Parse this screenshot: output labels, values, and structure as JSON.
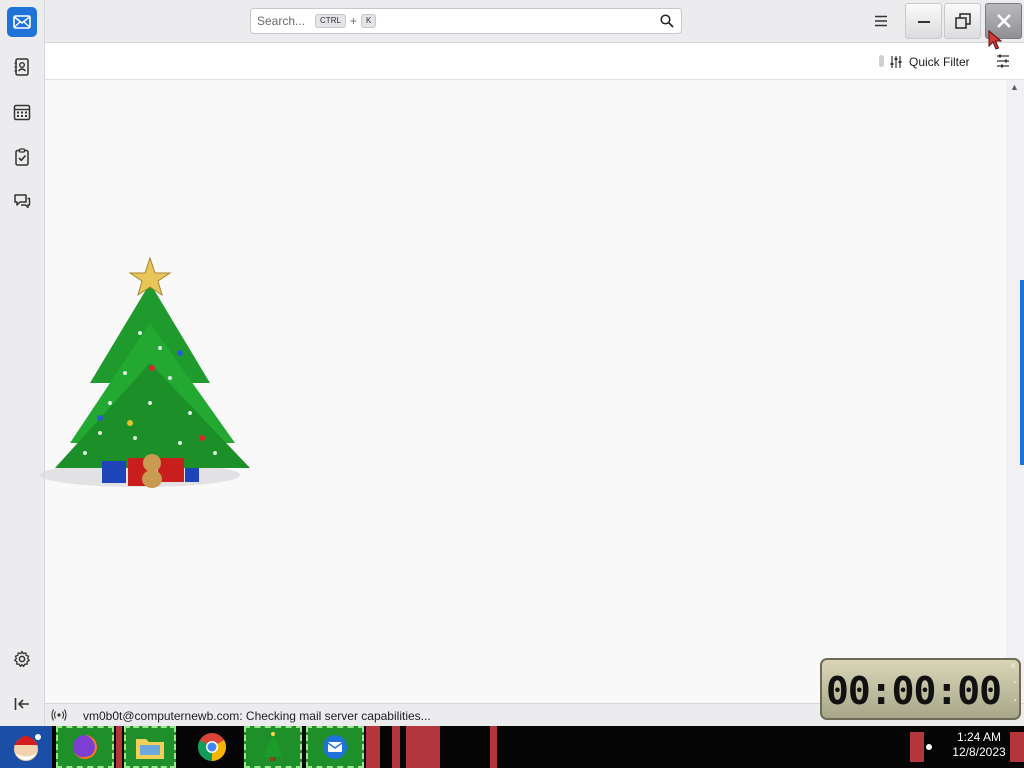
{
  "spaces": {
    "items": [
      {
        "name": "mail",
        "icon": "envelope-icon",
        "active": true
      },
      {
        "name": "address-book",
        "icon": "address-book-icon"
      },
      {
        "name": "calendar",
        "icon": "calendar-icon"
      },
      {
        "name": "tasks",
        "icon": "tasks-icon"
      },
      {
        "name": "chat",
        "icon": "chat-icon"
      }
    ],
    "bottom": [
      {
        "name": "settings",
        "icon": "gear-icon"
      },
      {
        "name": "collapse",
        "icon": "collapse-left-icon"
      }
    ]
  },
  "titlebar": {
    "search": {
      "placeholder": "Search...",
      "shortcut_mod": "CTRL",
      "shortcut_plus": "+",
      "shortcut_key": "K"
    }
  },
  "listbar": {
    "quick_filter_label": "Quick Filter"
  },
  "statusbar": {
    "text": "vm0b0t@computernewb.com: Checking mail server capabilities..."
  },
  "timer": {
    "display": "00:00:00",
    "close": "×"
  },
  "taskbar": {
    "clock_time": "1:24 AM",
    "clock_date": "12/8/2023"
  },
  "colors": {
    "accent": "#1f73d8",
    "taskbar": "#050505",
    "timer_bg": "#c9c6a6"
  }
}
